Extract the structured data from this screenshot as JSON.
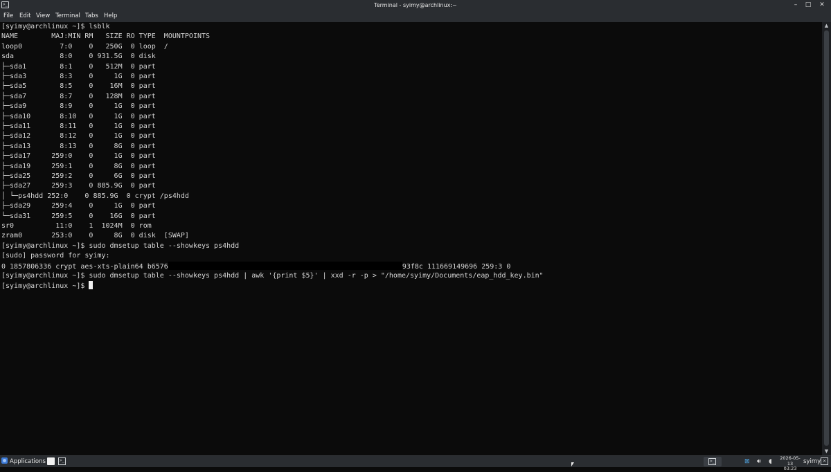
{
  "window": {
    "title": "Terminal - syimy@archlinux:~",
    "icon": "terminal-icon",
    "controls": {
      "minimize": "–",
      "maximize": "□",
      "close": "✕"
    }
  },
  "menu": [
    "File",
    "Edit",
    "View",
    "Terminal",
    "Tabs",
    "Help"
  ],
  "terminal": {
    "lines": [
      "[syimy@archlinux ~]$ lsblk",
      "NAME        MAJ:MIN RM   SIZE RO TYPE  MOUNTPOINTS",
      "loop0         7:0    0   250G  0 loop  /",
      "sda           8:0    0 931.5G  0 disk",
      "├─sda1        8:1    0   512M  0 part",
      "├─sda3        8:3    0     1G  0 part",
      "├─sda5        8:5    0    16M  0 part",
      "├─sda7        8:7    0   128M  0 part",
      "├─sda9        8:9    0     1G  0 part",
      "├─sda10       8:10   0     1G  0 part",
      "├─sda11       8:11   0     1G  0 part",
      "├─sda12       8:12   0     1G  0 part",
      "├─sda13       8:13   0     8G  0 part",
      "├─sda17     259:0    0     1G  0 part",
      "├─sda19     259:1    0     8G  0 part",
      "├─sda25     259:2    0     6G  0 part",
      "├─sda27     259:3    0 885.9G  0 part",
      "│ └─ps4hdd 252:0    0 885.9G  0 crypt /ps4hdd",
      "├─sda29     259:4    0     1G  0 part",
      "└─sda31     259:5    0    16G  0 part",
      "sr0          11:0    1  1024M  0 rom",
      "zram0       253:0    0     8G  0 disk  [SWAP]",
      "[syimy@archlinux ~]$ sudo dmsetup table --showkeys ps4hdd",
      "[sudo] password for syimy:"
    ],
    "key_line": {
      "before": "0 1857806336 crypt aes-xts-plain64 b6576",
      "after": "93f8c 111669149696 259:3 0"
    },
    "cmd_line": "[syimy@archlinux ~]$ sudo dmsetup table --showkeys ps4hdd | awk '{print $5}' | xxd -r -p > \"/home/syimy/Documents/eap_hdd_key.bin\"",
    "prompt": "[syimy@archlinux ~]$ "
  },
  "taskbar": {
    "applications_label": "Applications",
    "date": "2026-05-13",
    "time": "03:23",
    "user": "syimy",
    "icons": [
      "applications-icon",
      "document-icon",
      "terminal-icon",
      "network-icon",
      "volume-icon",
      "notification-icon",
      "system-icon"
    ]
  }
}
